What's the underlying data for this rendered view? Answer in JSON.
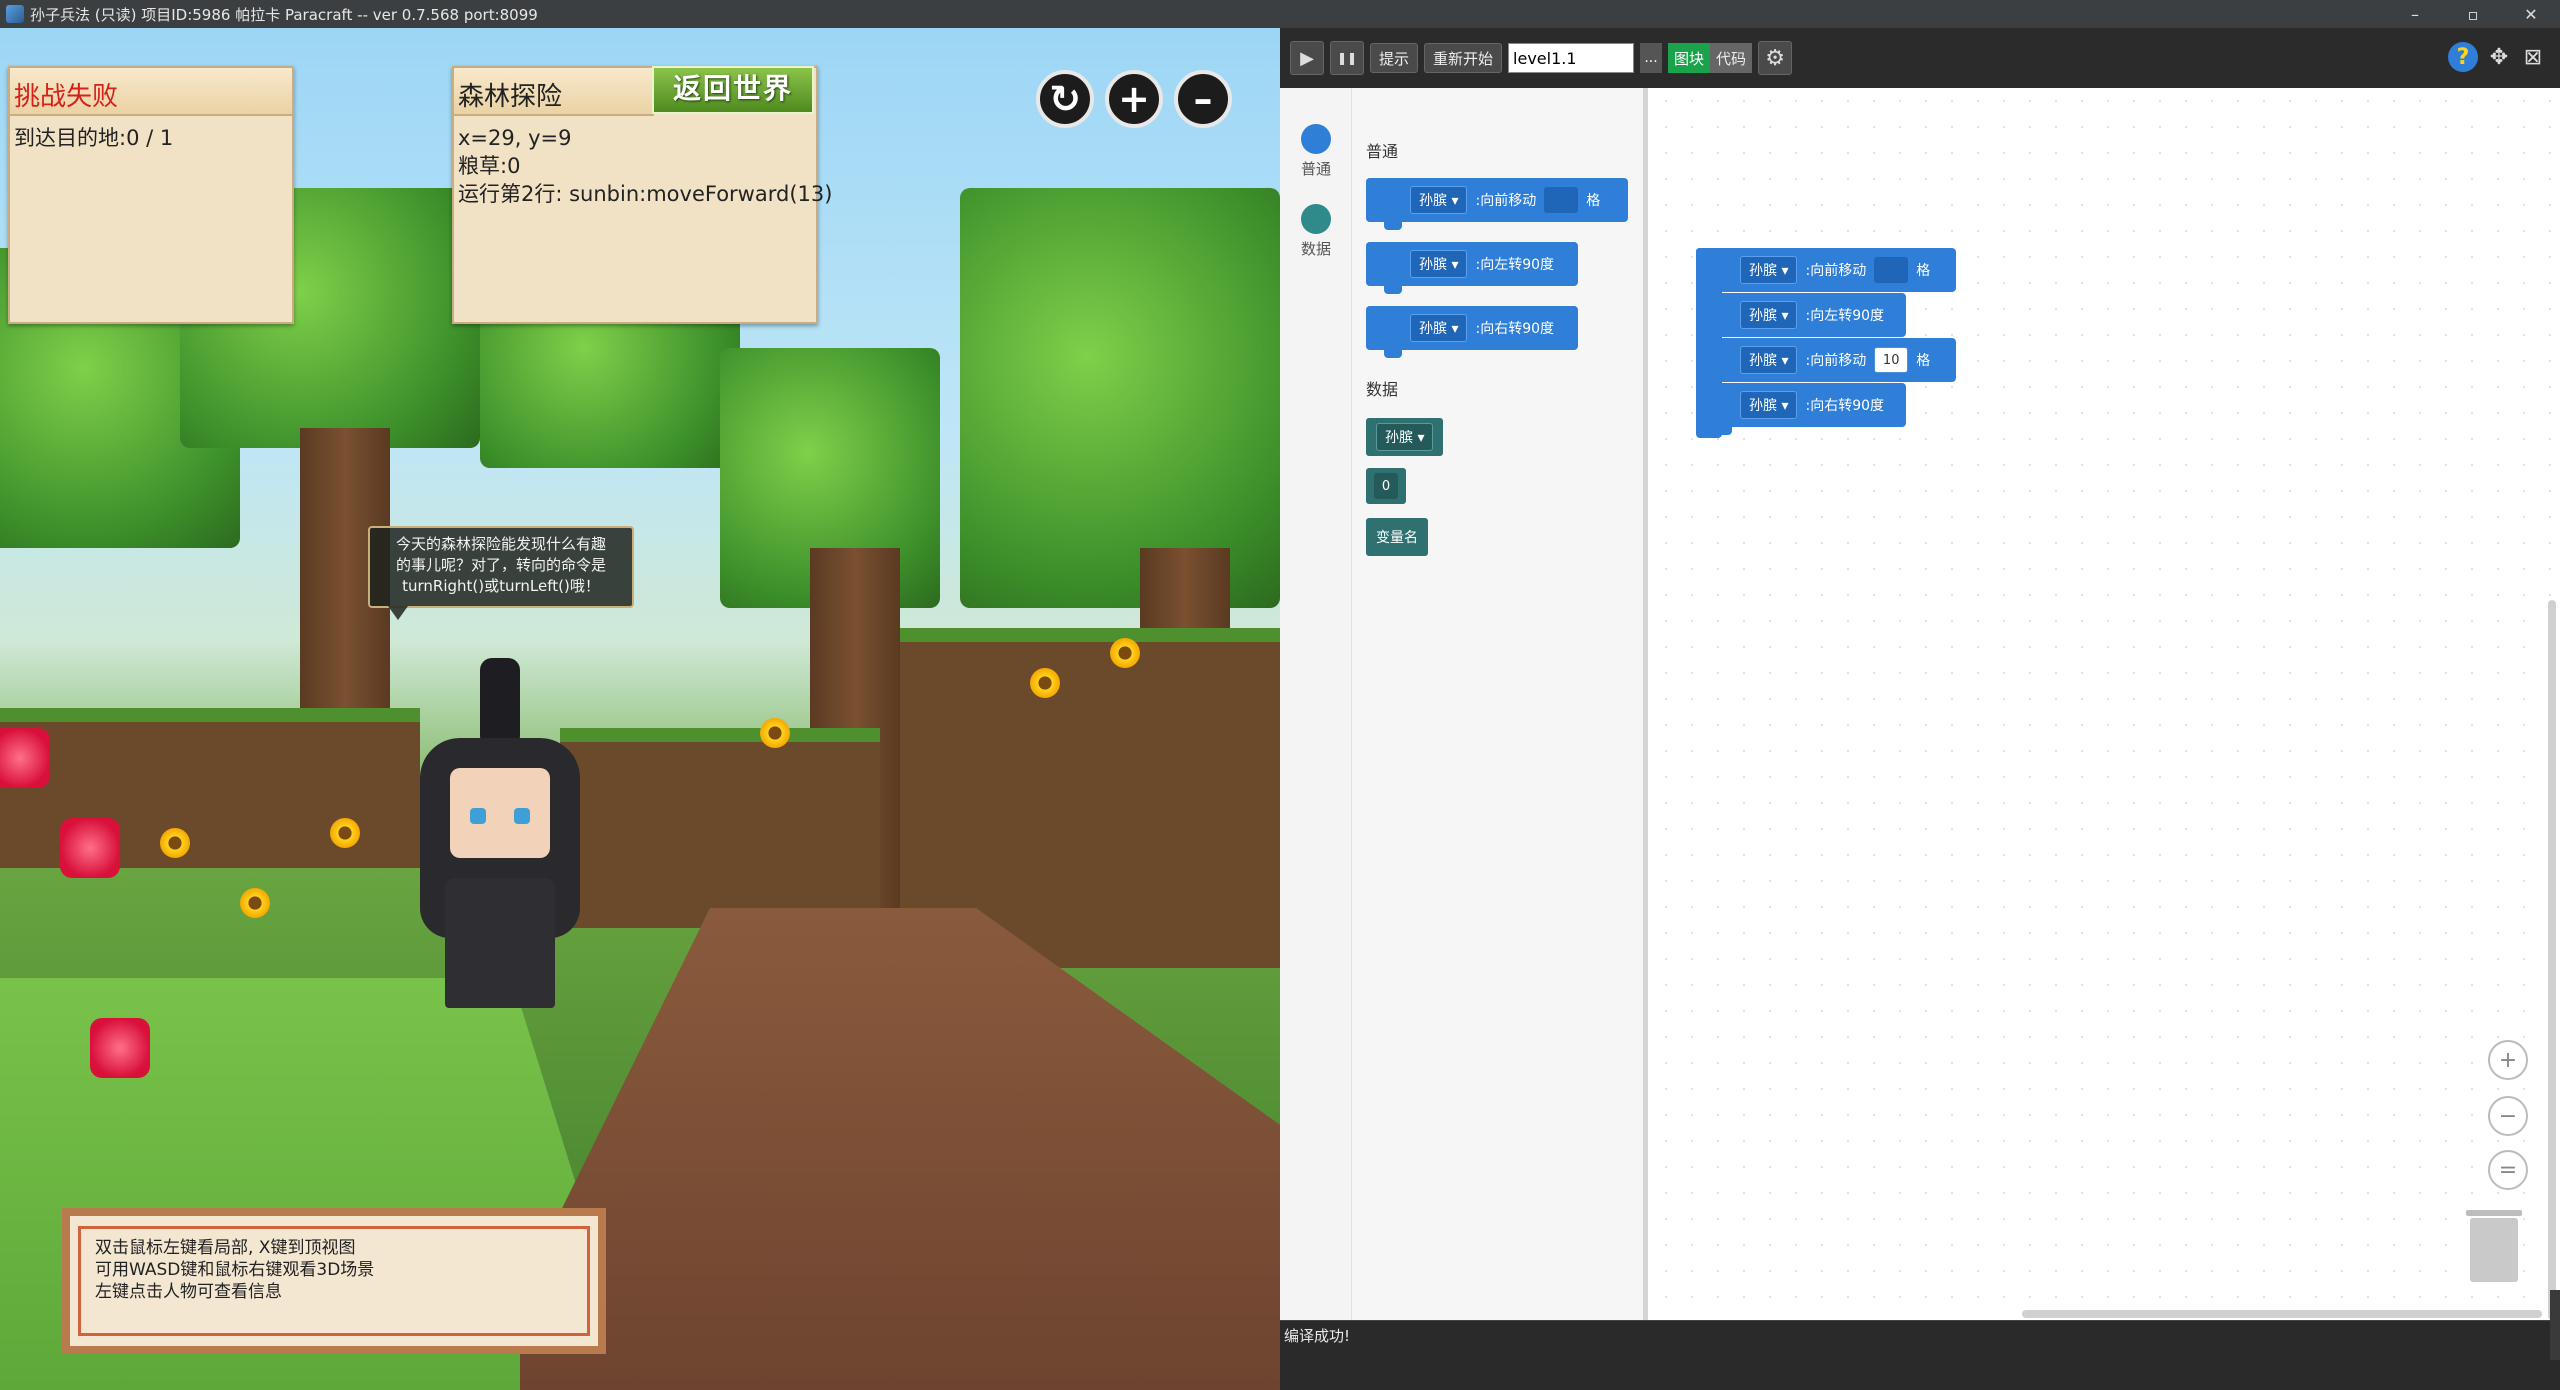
{
  "window": {
    "title": "孙子兵法 (只读) 项目ID:5986 帕拉卡 Paracraft -- ver 0.7.568 port:8099",
    "controls": [
      "–",
      "▫",
      "✕"
    ]
  },
  "game": {
    "fail_panel": {
      "header": "挑战失败",
      "progress_label": "到达目的地:0 / 1"
    },
    "forest_panel": {
      "header": "森林探险",
      "back_button": "返回世界",
      "coords": "x=29, y=9",
      "food": "粮草:0",
      "run_line": "运行第2行: sunbin:moveForward(13)"
    },
    "controls": {
      "refresh": "↻",
      "zoom_in": "+",
      "zoom_out": "–"
    },
    "speech": {
      "line1": "今天的森林探险能发现什么有趣",
      "line2": "的事儿呢？对了，转向的命令是",
      "line3": "turnRight()或turnLeft()哦！"
    },
    "help": {
      "line1": "双击鼠标左键看局部, X键到顶视图",
      "line2": "可用WASD键和鼠标右键观看3D场景",
      "line3": "左键点击人物可查看信息"
    }
  },
  "editor": {
    "toolbar": {
      "play": "▶",
      "pause": "❚❚",
      "hint": "提示",
      "restart": "重新开始",
      "level_value": "level1.1",
      "dots": "...",
      "blocks_toggle": "图块",
      "code_toggle": "代码",
      "settings": "⚙",
      "help_icon": "?",
      "move_icon": "✥",
      "close_icon": "⊠"
    },
    "categories": [
      {
        "label": "普通",
        "color": "#2f7fd8"
      },
      {
        "label": "数据",
        "color": "#2f8a8a"
      }
    ],
    "flyout": {
      "section_general": "普通",
      "section_data": "数据",
      "blocks": [
        {
          "actor": "孙膑",
          "action": ":向前移动",
          "value": "",
          "unit": "格"
        },
        {
          "actor": "孙膑",
          "action": ":向左转90度"
        },
        {
          "actor": "孙膑",
          "action": ":向右转90度"
        }
      ],
      "data_blocks": {
        "actor": "孙膑",
        "number": "0",
        "var_name": "变量名"
      }
    },
    "workspace": {
      "blocks": [
        {
          "actor": "孙膑",
          "action": ":向前移动",
          "value": "",
          "unit": "格"
        },
        {
          "actor": "孙膑",
          "action": ":向左转90度"
        },
        {
          "actor": "孙膑",
          "action": ":向前移动",
          "value": "10",
          "unit": "格"
        },
        {
          "actor": "孙膑",
          "action": ":向右转90度"
        }
      ],
      "zoom_in": "+",
      "zoom_out": "−",
      "reset": "="
    },
    "console": {
      "message": "编译成功!"
    }
  }
}
